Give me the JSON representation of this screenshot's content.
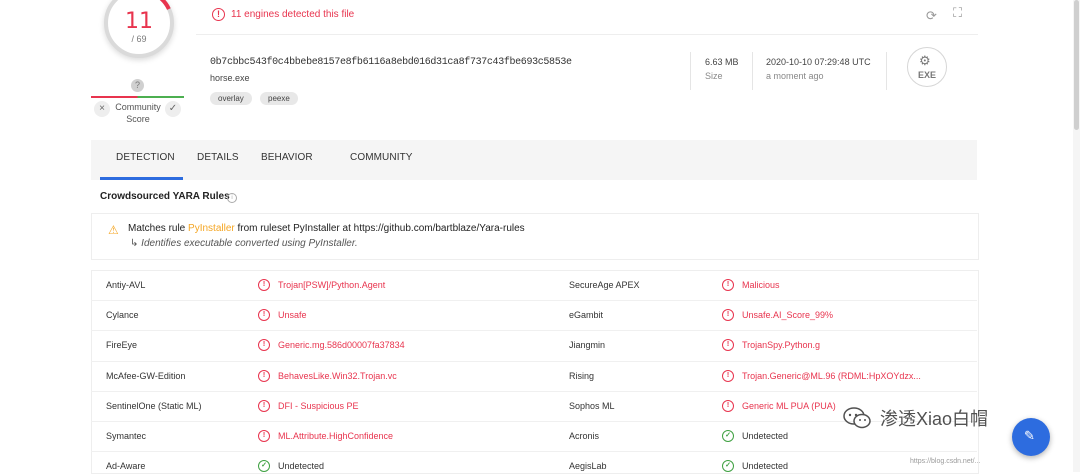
{
  "score": {
    "detected": "11",
    "total": "/ 69"
  },
  "community": {
    "help": "?",
    "label_line1": "Community",
    "label_line2": "Score",
    "down": "×",
    "up": "✓"
  },
  "header": {
    "alert": "11 engines detected this file",
    "hash": "0b7cbbc543f0c4bbebe8157e8fb6116a8ebd016d31ca8f737c43fbe693c5853e",
    "filename": "horse.exe",
    "tags": [
      "overlay",
      "peexe"
    ],
    "size_value": "6.63 MB",
    "size_label": "Size",
    "date_value": "2020-10-10 07:29:48 UTC",
    "date_label": "a moment ago",
    "filetype": "EXE"
  },
  "tabs": [
    "DETECTION",
    "DETAILS",
    "BEHAVIOR",
    "COMMUNITY"
  ],
  "yara": {
    "title": "Crowdsourced YARA Rules",
    "prefix": "Matches rule ",
    "rule": "PyInstaller",
    "suffix": " from ruleset PyInstaller at https://github.com/bartblaze/Yara-rules",
    "arrow": "↳",
    "description": "Identifies executable converted using PyInstaller."
  },
  "detections": [
    {
      "engine": "Antiy-AVL",
      "result": "Trojan[PSW]/Python.Agent",
      "status": "malicious"
    },
    {
      "engine": "SecureAge APEX",
      "result": "Malicious",
      "status": "malicious"
    },
    {
      "engine": "Cylance",
      "result": "Unsafe",
      "status": "malicious"
    },
    {
      "engine": "eGambit",
      "result": "Unsafe.AI_Score_99%",
      "status": "malicious"
    },
    {
      "engine": "FireEye",
      "result": "Generic.mg.586d00007fa37834",
      "status": "malicious"
    },
    {
      "engine": "Jiangmin",
      "result": "TrojanSpy.Python.g",
      "status": "malicious"
    },
    {
      "engine": "McAfee-GW-Edition",
      "result": "BehavesLike.Win32.Trojan.vc",
      "status": "malicious"
    },
    {
      "engine": "Rising",
      "result": "Trojan.Generic@ML.96 (RDML:HpXOYdzx...",
      "status": "malicious"
    },
    {
      "engine": "SentinelOne (Static ML)",
      "result": "DFI - Suspicious PE",
      "status": "malicious"
    },
    {
      "engine": "Sophos ML",
      "result": "Generic ML PUA (PUA)",
      "status": "malicious"
    },
    {
      "engine": "Symantec",
      "result": "ML.Attribute.HighConfidence",
      "status": "malicious"
    },
    {
      "engine": "Acronis",
      "result": "Undetected",
      "status": "undetected"
    },
    {
      "engine": "Ad-Aware",
      "result": "Undetected",
      "status": "undetected"
    },
    {
      "engine": "AegisLab",
      "result": "Undetected",
      "status": "undetected"
    }
  ],
  "watermark": {
    "text": "渗透Xiao白帽",
    "url": "https://blog.csdn.net/..."
  },
  "colors": {
    "malicious": "#e8344e",
    "undetected": "#3fa142",
    "accent": "#2d6cdf",
    "warning": "#f5a623"
  }
}
